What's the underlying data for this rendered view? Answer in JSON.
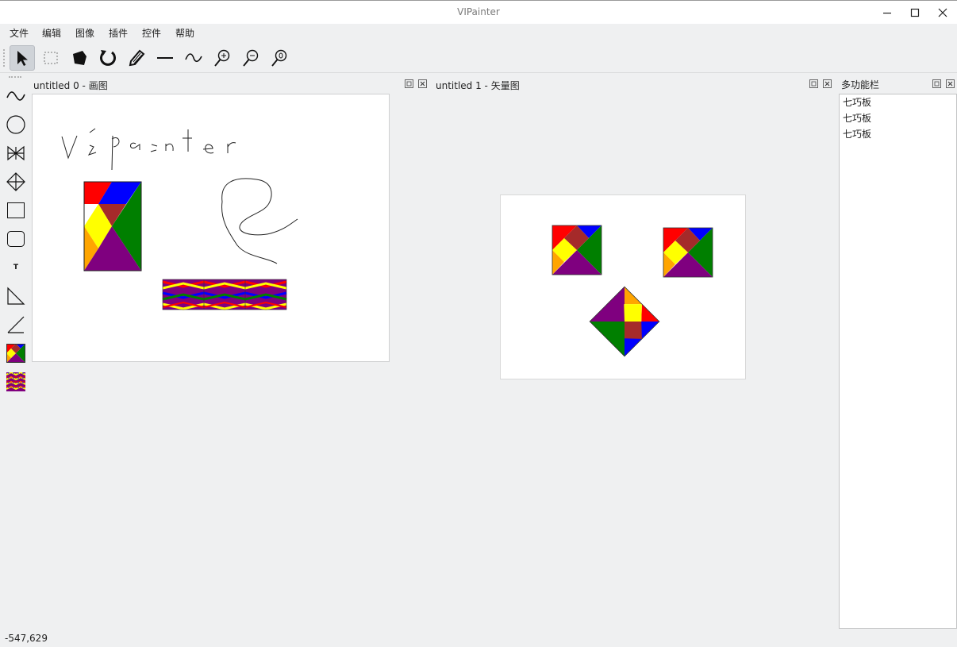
{
  "window": {
    "title": "VIPainter"
  },
  "menubar": {
    "items": [
      "文件",
      "编辑",
      "图像",
      "插件",
      "控件",
      "帮助"
    ]
  },
  "toolbar": {
    "tools": [
      "pointer-icon",
      "rect-select-icon",
      "fill-icon",
      "rotate-icon",
      "pencil-icon",
      "line-icon",
      "curve-icon",
      "zoom-in-icon",
      "zoom-out-icon",
      "zoom-reset-icon"
    ],
    "active": "pointer-icon"
  },
  "left_toolbar": {
    "tools": [
      "wave-icon",
      "circle-icon",
      "bowtie-icon",
      "diamond-icon",
      "rectangle-icon",
      "rounded-rect-icon",
      "text-tool-icon",
      "triangle-icon",
      "diagonal-line-icon",
      "tangram-icon",
      "pattern-icon"
    ],
    "text_tool_label": "T"
  },
  "subwindows": {
    "paint": {
      "title": "untitled 0 - 画图",
      "handwriting": "Vipainter"
    },
    "vector": {
      "title": "untitled 1 - 矢量图"
    }
  },
  "dock": {
    "title": "多功能栏",
    "items": [
      "七巧板",
      "七巧板",
      "七巧板"
    ]
  },
  "status": {
    "coords": "-547,629"
  },
  "colors": {
    "red": "#ff0000",
    "blue": "#0000ff",
    "yellow": "#ffff00",
    "green": "#007f00",
    "purple": "#7f007f",
    "orange": "#ffa500",
    "brown": "#a52a2a"
  }
}
